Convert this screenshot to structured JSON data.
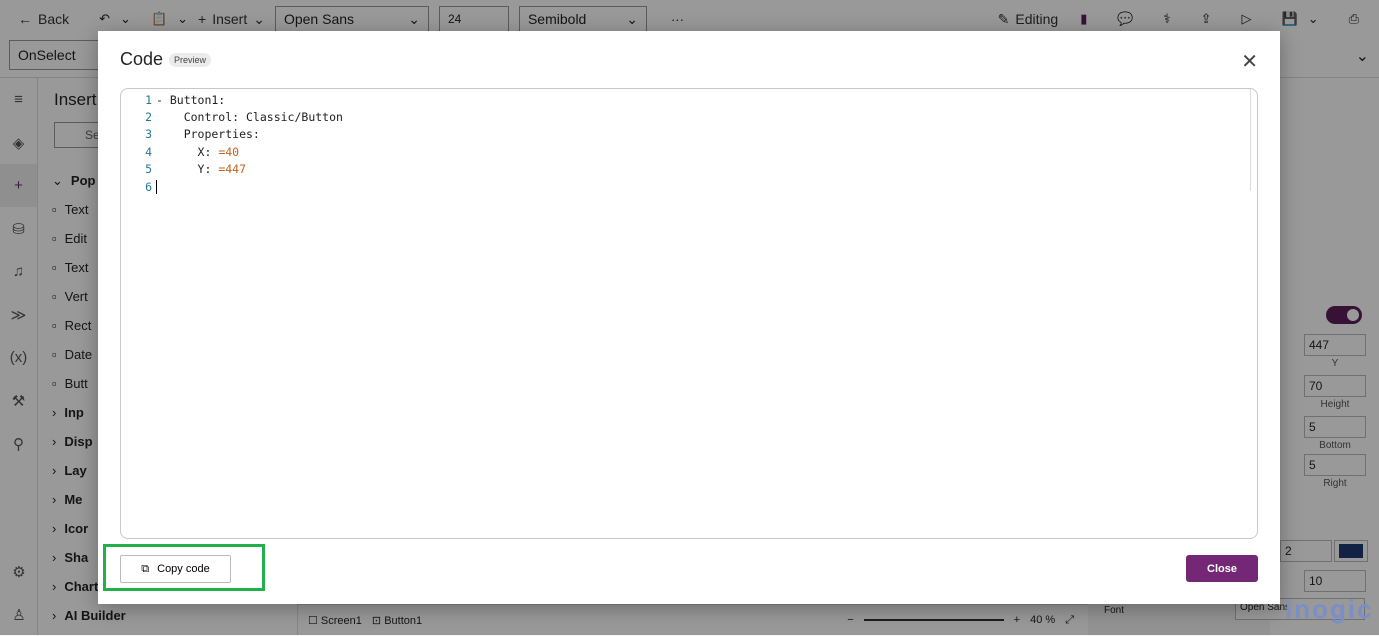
{
  "toolbar": {
    "back": "Back",
    "insert": "Insert",
    "font": "Open Sans",
    "size": "24",
    "weight": "Semibold",
    "more": "···",
    "editing": "Editing"
  },
  "formula": {
    "property": "OnSelect"
  },
  "insert_panel": {
    "title": "Insert",
    "search_placeholder": "Se",
    "items": [
      "Pop",
      "Text",
      "Edit",
      "Text",
      "Vert",
      "Rect",
      "Date",
      "Butt",
      "Inp",
      "Disp",
      "Lay",
      "Me",
      "Icor",
      "Sha",
      "Charts",
      "AI Builder"
    ]
  },
  "right_panel": {
    "toggle_label": "On",
    "y": "447",
    "y_label": "Y",
    "height": "70",
    "height_label": "Height",
    "bottom": "5",
    "bottom_label": "Bottom",
    "right": "5",
    "right_label": "Right",
    "border": "2",
    "radius": "10",
    "font_label": "Font",
    "font_value": "Open Sans",
    "swatch": "#1f3a73"
  },
  "status": {
    "screen": "Screen1",
    "control": "Button1",
    "zoom": "40",
    "zoom_unit": "%"
  },
  "dialog": {
    "title": "Code",
    "badge": "Preview",
    "copy_label": "Copy code",
    "close_label": "Close",
    "accent": "#742774",
    "highlight": "#22b04b",
    "lines": [
      {
        "n": "1",
        "key": "- Button1:",
        "val": ""
      },
      {
        "n": "2",
        "key": "    Control: Classic/Button",
        "val": ""
      },
      {
        "n": "3",
        "key": "    Properties:",
        "val": ""
      },
      {
        "n": "4",
        "key": "      X: ",
        "val": "=40"
      },
      {
        "n": "5",
        "key": "      Y: ",
        "val": "=447"
      },
      {
        "n": "6",
        "key": "",
        "val": ""
      }
    ]
  },
  "watermark": "inogic"
}
